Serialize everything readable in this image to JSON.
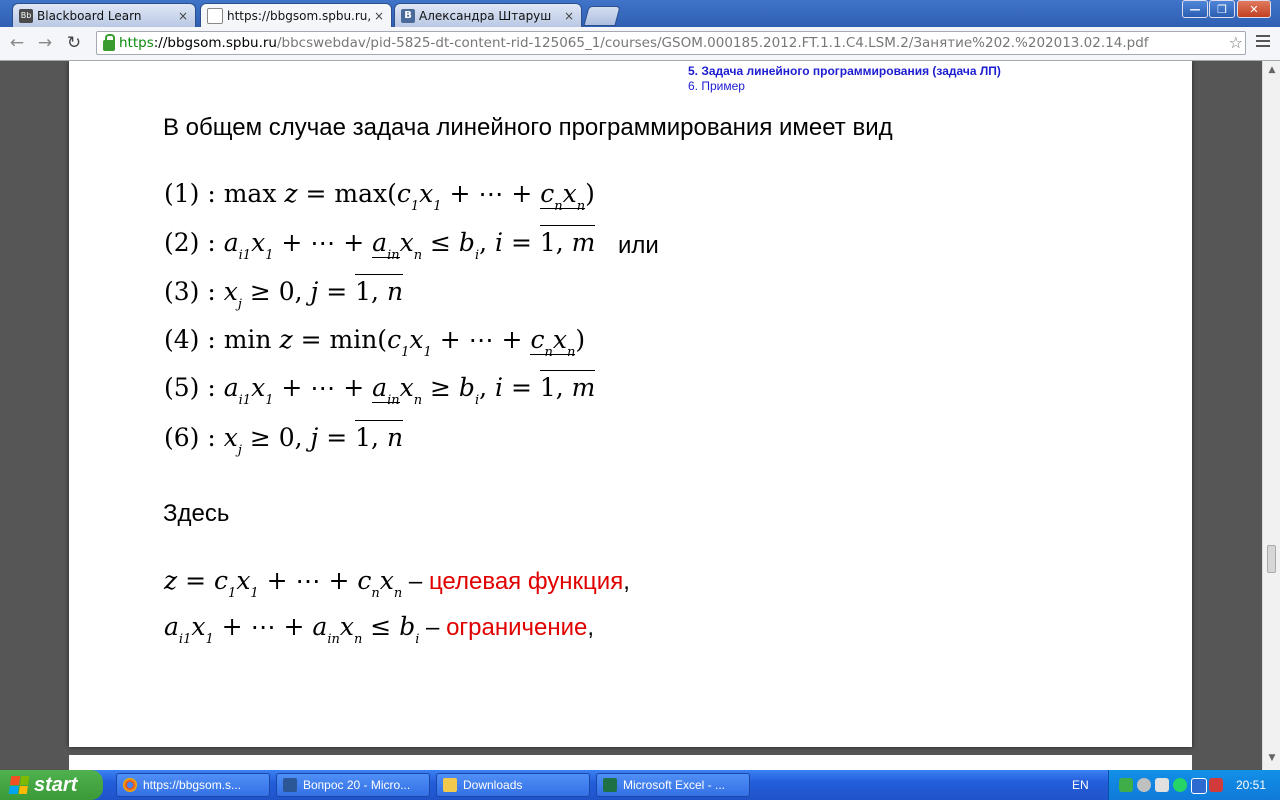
{
  "tabs": [
    {
      "icon": "blackboard-favicon",
      "icon_text": "Bb",
      "title": "Blackboard Learn",
      "close": "×"
    },
    {
      "icon": "document-favicon",
      "icon_text": "",
      "title": "https://bbgsom.spbu.ru,",
      "close": "×"
    },
    {
      "icon": "vk-favicon",
      "icon_text": "B",
      "title": "Александра Штаруш",
      "close": "×"
    }
  ],
  "window_controls": {
    "minimize": "—",
    "restore": "❐",
    "close": "✕"
  },
  "toolbar": {
    "back": "←",
    "forward": "→",
    "reload": "↻",
    "star": "☆"
  },
  "address": {
    "scheme": "https",
    "host": "://bbgsom.spbu.ru",
    "path": "/bbcswebdav/pid-5825-dt-content-rid-125065_1/courses/GSOM.000185.2012.FT.1.1.C4.LSM.2/Занятие%202.%202013.02.14.pdf"
  },
  "doc": {
    "nav": [
      "5. Задача линейного программирования (задача ЛП)",
      "6. Пример"
    ],
    "heading": "В общем случае задача линейного программирования имеет вид",
    "or_word": "или",
    "here": "Здесь",
    "goal_label": "целевая функция",
    "constraint_label": "ограничение",
    "dash": " – ",
    "comma": ","
  },
  "taskbar": {
    "start": "start",
    "items": [
      {
        "icon": "chrome-icon",
        "label": "https://bbgsom.s..."
      },
      {
        "icon": "word-icon",
        "label": "Вопрос 20 - Micro..."
      },
      {
        "icon": "folder-icon",
        "label": "Downloads"
      },
      {
        "icon": "excel-icon",
        "label": "Microsoft Excel - ..."
      }
    ],
    "lang": "EN",
    "clock": "20:51"
  },
  "colors": {
    "accent": "#e00000",
    "link": "#1d1dd1",
    "omnibox_scheme": "#0a8a0a"
  }
}
